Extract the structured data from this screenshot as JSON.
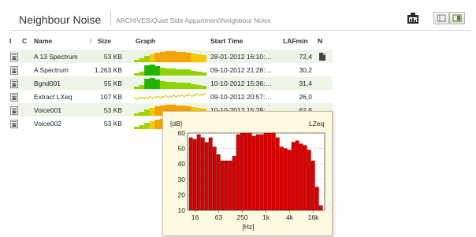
{
  "header": {
    "title": "Neighbour Noise",
    "breadcrumb": "ARCHIVES\\Quiet Side Appartment\\Neighbour Noise"
  },
  "toolbar": {
    "icons": [
      "report-icon",
      "view-list-icon",
      "view-detail-icon"
    ]
  },
  "columns": {
    "i": "I",
    "c": "C",
    "name": "Name",
    "sort_indicator": "/",
    "size": "Size",
    "graph": "Graph",
    "start_time": "Start Time",
    "lafmin": "LAFmin",
    "n": "N"
  },
  "rows": [
    {
      "name": "A 13 Spectrum",
      "size": "53 KB",
      "start_time": "28-01-2012 16:10:…",
      "lafmin": "72,4",
      "graph": "spectrum",
      "note": true
    },
    {
      "name": "A Spectrum",
      "size": "1.263 KB",
      "start_time": "09-10-2012 21:28:…",
      "lafmin": "30,2",
      "graph": "spectrum-green",
      "note": false
    },
    {
      "name": "Bgnd001",
      "size": "55 KB",
      "start_time": "10-10-2012 15:36:…",
      "lafmin": "31,4",
      "graph": "spectrum-green",
      "note": false
    },
    {
      "name": "Extract LXeq",
      "size": "107 KB",
      "start_time": "09-10-2012 20:57:…",
      "lafmin": "26,0",
      "graph": "profile",
      "note": false
    },
    {
      "name": "Voice001",
      "size": "53 KB",
      "start_time": "10-10-2012 15:28:…",
      "lafmin": "62,6",
      "graph": "spectrum",
      "note": false
    },
    {
      "name": "Voice002",
      "size": "53 KB",
      "start_time": "",
      "lafmin": "",
      "graph": "spectrum",
      "note": false
    }
  ],
  "popup": {
    "unit_label": "[dB]",
    "series_label": "LZeq",
    "x_label": "[Hz]",
    "bar_color": "#dd0000"
  },
  "chart_data": {
    "type": "bar",
    "title": "",
    "xlabel": "[Hz]",
    "ylabel": "[dB]",
    "ylim": [
      10,
      60
    ],
    "yticks": [
      10,
      20,
      30,
      40,
      50,
      60
    ],
    "xtick_labels": [
      "16",
      "63",
      "250",
      "1k",
      "4k",
      "16k"
    ],
    "series": [
      {
        "name": "LZeq",
        "values": [
          57,
          56,
          59,
          57,
          54,
          57,
          51,
          46,
          42,
          42,
          42,
          45,
          59,
          60,
          60,
          60,
          58,
          59,
          59,
          60,
          60,
          60,
          57,
          51,
          50,
          49,
          54,
          55,
          53,
          52,
          49,
          42,
          25,
          13
        ]
      }
    ]
  }
}
